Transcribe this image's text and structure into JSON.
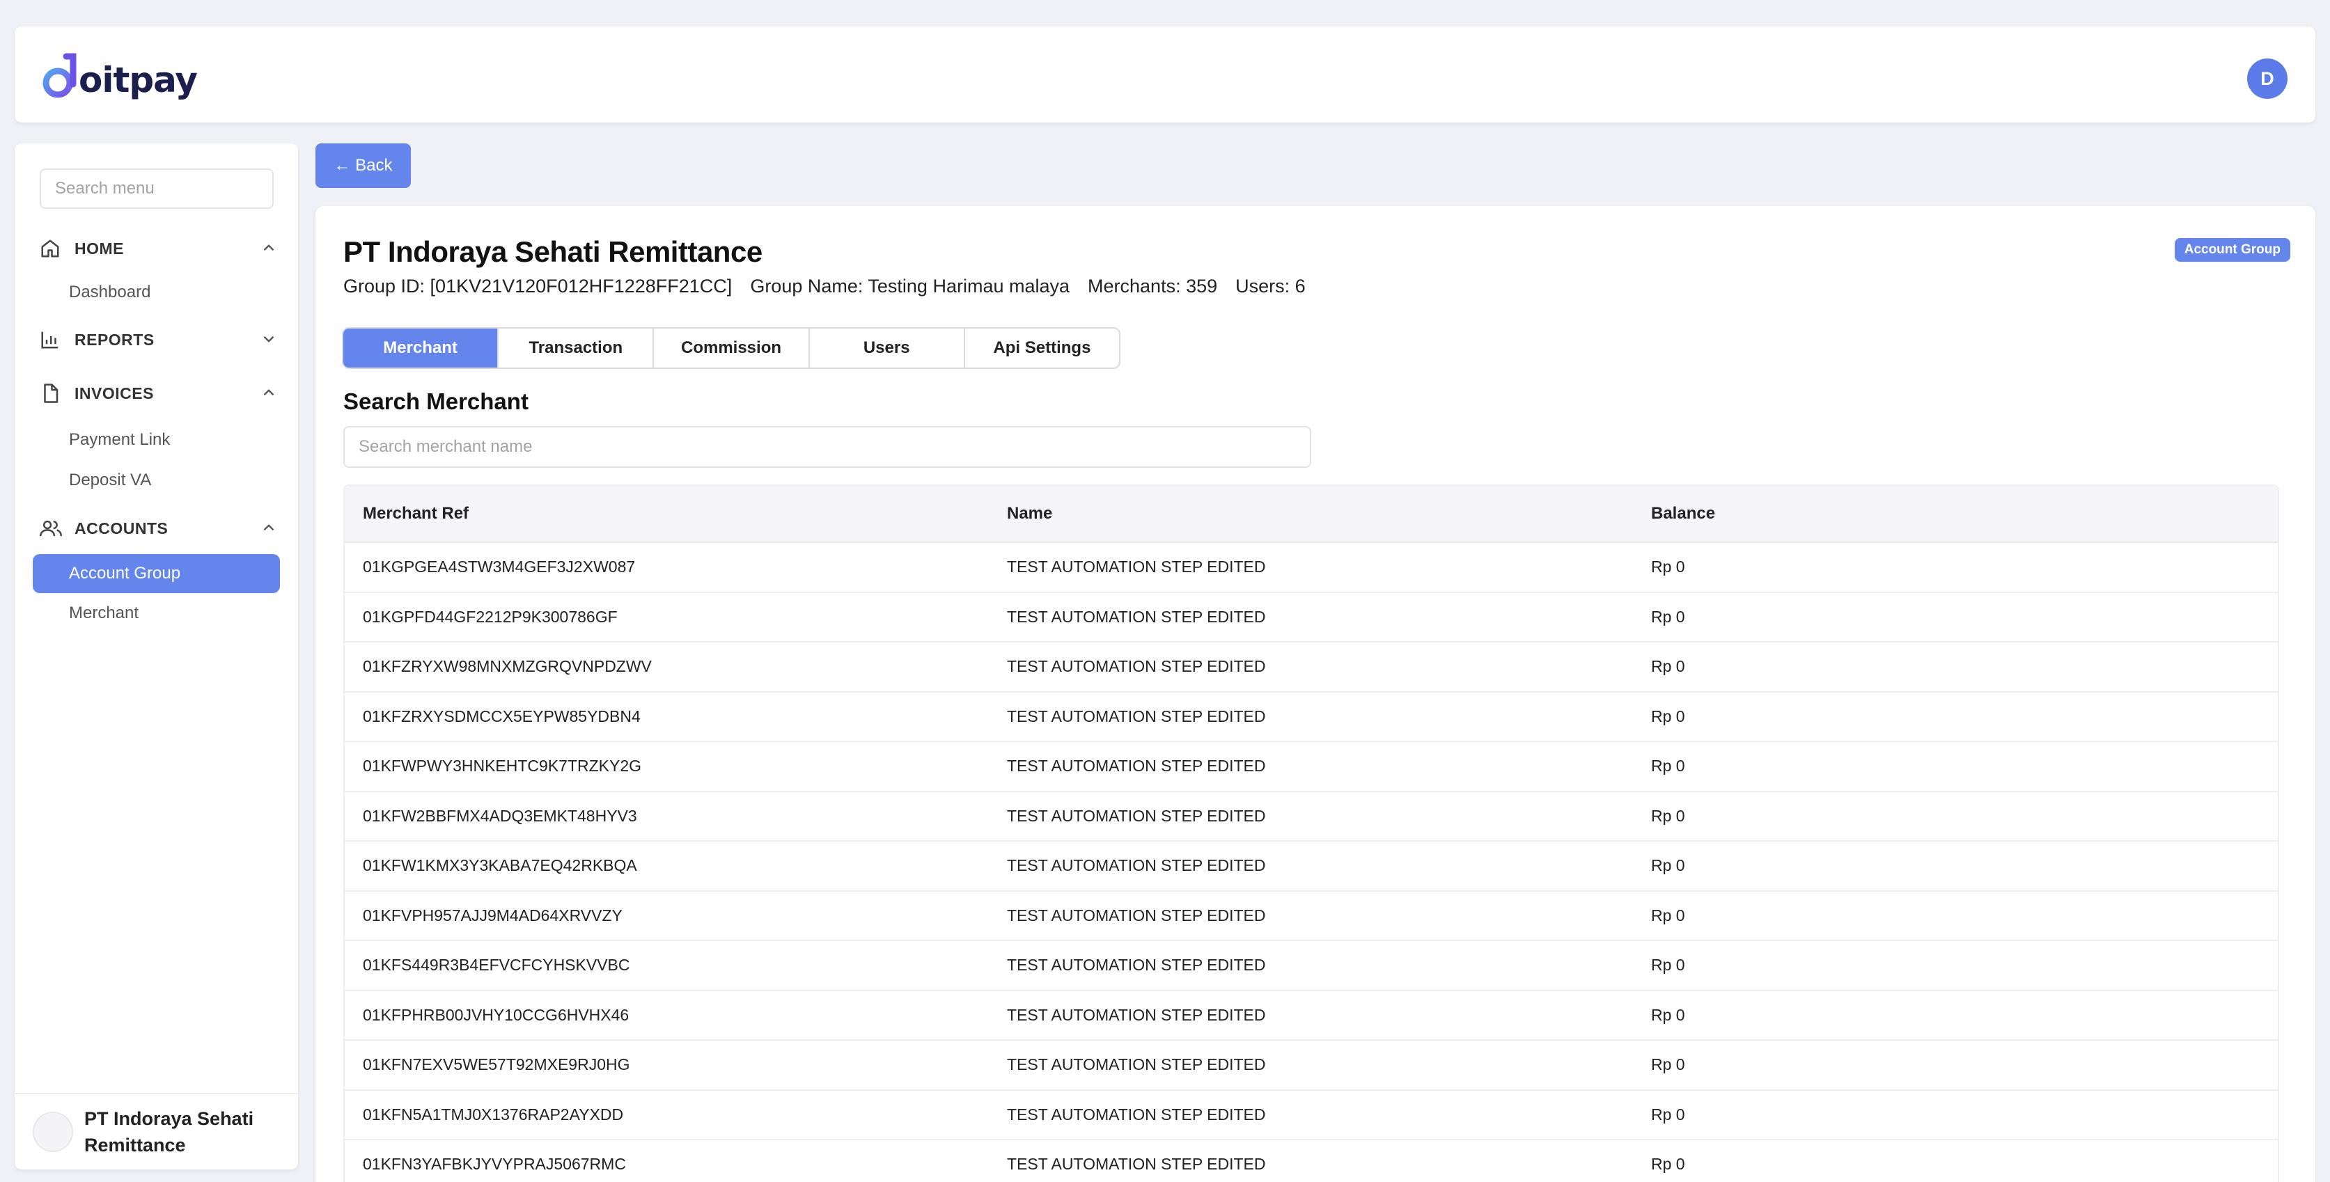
{
  "header": {
    "logo_text": "oitpay",
    "user_initial": "D"
  },
  "sidebar": {
    "search_placeholder": "Search menu",
    "sections": {
      "home": {
        "label": "HOME",
        "items": [
          "Dashboard"
        ]
      },
      "reports": {
        "label": "REPORTS"
      },
      "invoices": {
        "label": "INVOICES",
        "items": [
          "Payment Link",
          "Deposit VA"
        ]
      },
      "accounts": {
        "label": "ACCOUNTS",
        "items": [
          "Account Group",
          "Merchant"
        ]
      }
    },
    "active_item": "Account Group",
    "footer_name": "PT Indoraya Sehati Remittance"
  },
  "back_label": "← Back",
  "main": {
    "title": "PT Indoraya Sehati Remittance",
    "badge": "Account Group",
    "group_id": "Group ID: [01KV21V120F012HF1228FF21CC]",
    "group_name": "Group Name: Testing Harimau malaya",
    "merchants": "Merchants: 359",
    "users": "Users: 6",
    "tabs": [
      "Merchant",
      "Transaction",
      "Commission",
      "Users",
      "Api Settings"
    ],
    "active_tab": "Merchant",
    "section_title": "Search Merchant",
    "search_placeholder": "Search merchant name"
  },
  "table": {
    "columns": [
      "Merchant Ref",
      "Name",
      "Balance"
    ],
    "rows": [
      [
        "01KGPGEA4STW3M4GEF3J2XW087",
        "TEST AUTOMATION STEP EDITED",
        "Rp 0"
      ],
      [
        "01KGPFD44GF2212P9K300786GF",
        "TEST AUTOMATION STEP EDITED",
        "Rp 0"
      ],
      [
        "01KFZRYXW98MNXMZGRQVNPDZWV",
        "TEST AUTOMATION STEP EDITED",
        "Rp 0"
      ],
      [
        "01KFZRXYSDMCCX5EYPW85YDBN4",
        "TEST AUTOMATION STEP EDITED",
        "Rp 0"
      ],
      [
        "01KFWPWY3HNKEHTC9K7TRZKY2G",
        "TEST AUTOMATION STEP EDITED",
        "Rp 0"
      ],
      [
        "01KFW2BBFMX4ADQ3EMKT48HYV3",
        "TEST AUTOMATION STEP EDITED",
        "Rp 0"
      ],
      [
        "01KFW1KMX3Y3KABA7EQ42RKBQA",
        "TEST AUTOMATION STEP EDITED",
        "Rp 0"
      ],
      [
        "01KFVPH957AJJ9M4AD64XRVVZY",
        "TEST AUTOMATION STEP EDITED",
        "Rp 0"
      ],
      [
        "01KFS449R3B4EFVCFCYHSKVVBC",
        "TEST AUTOMATION STEP EDITED",
        "Rp 0"
      ],
      [
        "01KFPHRB00JVHY10CCG6HVHX46",
        "TEST AUTOMATION STEP EDITED",
        "Rp 0"
      ],
      [
        "01KFN7EXV5WE57T92MXE9RJ0HG",
        "TEST AUTOMATION STEP EDITED",
        "Rp 0"
      ],
      [
        "01KFN5A1TMJ0X1376RAP2AYXDD",
        "TEST AUTOMATION STEP EDITED",
        "Rp 0"
      ],
      [
        "01KFN3YAFBKJYVYPRAJ5067RMC",
        "TEST AUTOMATION STEP EDITED",
        "Rp 0"
      ]
    ]
  },
  "colors": {
    "accent": "#6486ec",
    "background": "#f0f1f7"
  }
}
